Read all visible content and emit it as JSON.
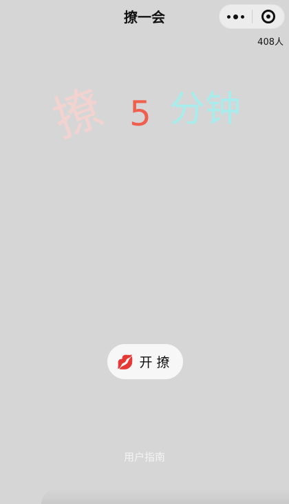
{
  "nav": {
    "title": "撩一会"
  },
  "capsule": {
    "more_icon": "more-dots-icon",
    "close_icon": "target-close-icon"
  },
  "online_count": "408人",
  "hero": {
    "liao": "撩",
    "number": "5",
    "minutes": "分钟",
    "colors": {
      "liao": "#f3d3d0",
      "number": "#f05f4e",
      "minutes": "#a8ecec"
    }
  },
  "start_button": {
    "icon": "💋",
    "label": "开撩"
  },
  "guide_link": "用户指南"
}
